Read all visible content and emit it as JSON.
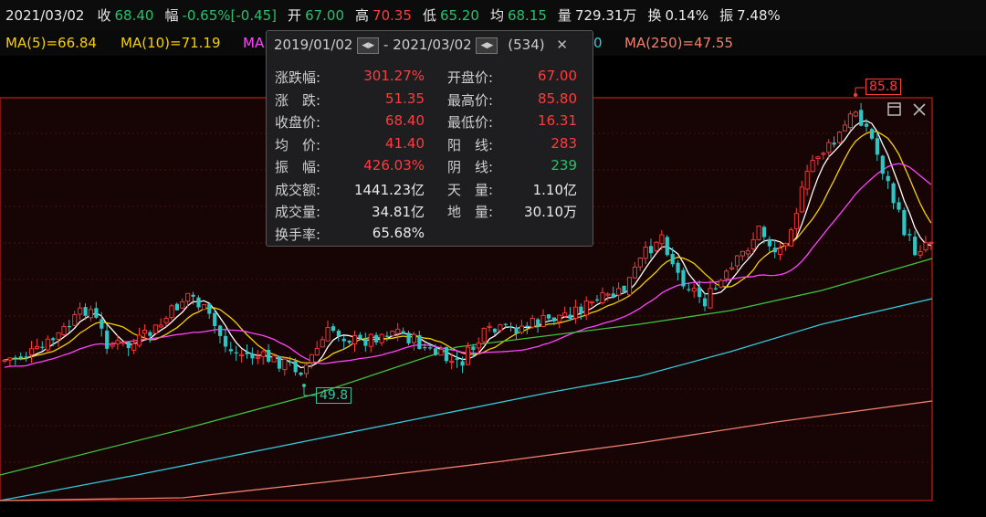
{
  "quote": {
    "date": "2021/03/02",
    "close_label": "收",
    "close_value": "68.40",
    "change_label": "幅",
    "change_value": "-0.65%[-0.45]",
    "open_label": "开",
    "open_value": "67.00",
    "high_label": "高",
    "high_value": "70.35",
    "low_label": "低",
    "low_value": "65.20",
    "avg_label": "均",
    "avg_value": "68.15",
    "volume_label": "量",
    "volume_value": "729.31万",
    "turnover_label": "换",
    "turnover_value": "0.14%",
    "amplitude_label": "振",
    "amplitude_value": "7.48%"
  },
  "ma_legend": {
    "ma5": "MA(5)=66.84",
    "ma10": "MA(10)=71.19",
    "ma20_partial": "MA",
    "ma120_partial": "0",
    "ma250": "MA(250)=47.55"
  },
  "range_panel": {
    "start_date": "2019/01/02",
    "separator": "-",
    "end_date": "2021/03/02",
    "count": "(534)",
    "close_glyph": "✕",
    "rows": [
      {
        "k1": "涨跌幅:",
        "v1": "301.27%",
        "k2": "开盘价:",
        "v2": "67.00"
      },
      {
        "k1": "涨　跌:",
        "v1": "51.35",
        "k2": "最高价:",
        "v2": "85.80"
      },
      {
        "k1": "收盘价:",
        "v1": "68.40",
        "k2": "最低价:",
        "v2": "16.31"
      },
      {
        "k1": "均　价:",
        "v1": "41.40",
        "k2": "阳　线:",
        "v2": "283"
      },
      {
        "k1": "振　幅:",
        "v1": "426.03%",
        "k2": "阴　线:",
        "v2": "239"
      },
      {
        "k1": "成交额:",
        "v1": "1441.23亿",
        "k2": "天　量:",
        "v2": "1.10亿"
      },
      {
        "k1": "成交量:",
        "v1": "34.81亿",
        "k2": "地　量:",
        "v2": "30.10万"
      },
      {
        "k1": "换手率:",
        "v1": "65.68%",
        "k2": "",
        "v2": ""
      }
    ]
  },
  "markers": {
    "high_label": "85.8",
    "low_label": "49.8"
  },
  "colors": {
    "up": "#ff3b3b",
    "down": "#2ec5c5",
    "ma5": "#ffffff",
    "ma10": "#f5d000",
    "ma20": "#ff44ff",
    "ma60": "#3fc23f",
    "ma120": "#33ccdd",
    "ma250": "#f08070",
    "frame": "#c01e1e"
  },
  "icons": {
    "maximize": "window-maximize-icon",
    "close": "close-icon"
  }
}
